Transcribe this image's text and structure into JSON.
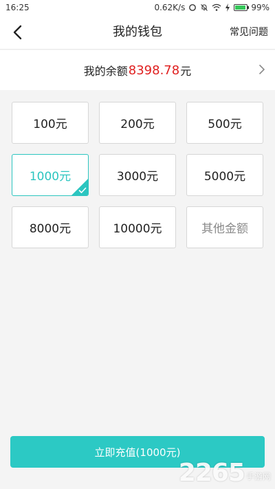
{
  "status_bar": {
    "time": "16:25",
    "network_speed": "0.62K/s",
    "battery": "99%",
    "battery_level": 0.99,
    "icons": [
      "sync-icon",
      "silent-icon",
      "wifi-icon",
      "charging-icon",
      "battery-icon"
    ]
  },
  "header": {
    "title": "我的钱包",
    "faq": "常见问题",
    "back_icon": "chevron-left-icon"
  },
  "balance": {
    "prefix": "我的余额",
    "amount": "8398.78",
    "suffix": "元",
    "chevron_icon": "chevron-right-icon"
  },
  "amounts": [
    {
      "label": "100元",
      "selected": false
    },
    {
      "label": "200元",
      "selected": false
    },
    {
      "label": "500元",
      "selected": false
    },
    {
      "label": "1000元",
      "selected": true
    },
    {
      "label": "3000元",
      "selected": false
    },
    {
      "label": "5000元",
      "selected": false
    },
    {
      "label": "8000元",
      "selected": false
    },
    {
      "label": "10000元",
      "selected": false
    },
    {
      "label": "其他金额",
      "selected": false
    }
  ],
  "recharge_button": "立即充值(1000元)",
  "watermark": {
    "number": "2265",
    "site": "手游网"
  },
  "colors": {
    "accent": "#2cc5c0",
    "button": "#2cc9c4",
    "balance_amount": "#e02020",
    "background": "#f4f4f4"
  }
}
